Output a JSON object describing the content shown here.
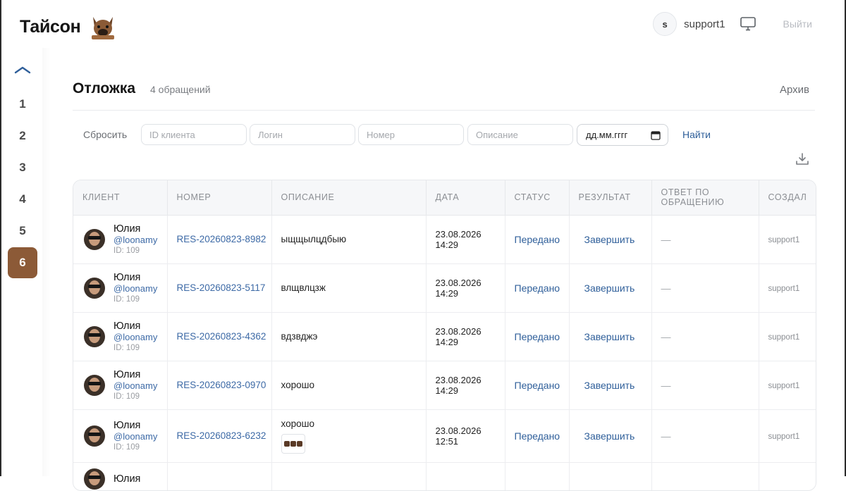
{
  "header": {
    "brand": "Тайсон",
    "user_initial": "s",
    "username": "support1",
    "logout": "Выйти"
  },
  "rail": {
    "items": [
      "1",
      "2",
      "3",
      "4",
      "5",
      "6"
    ],
    "active": "6"
  },
  "page": {
    "title": "Отложка",
    "count": "4 обращений",
    "archive": "Архив"
  },
  "filters": {
    "reset": "Сбросить",
    "client_id_placeholder": "ID клиента",
    "login_placeholder": "Логин",
    "number_placeholder": "Номер",
    "description_placeholder": "Описание",
    "date_placeholder": "дд.мм.гггг",
    "find": "Найти"
  },
  "table": {
    "columns": [
      "КЛИЕНТ",
      "НОМЕР",
      "ОПИСАНИЕ",
      "ДАТА",
      "СТАТУС",
      "РЕЗУЛЬТАТ",
      "ОТВЕТ ПО ОБРАЩЕНИЮ",
      "СОЗДАЛ"
    ],
    "rows": [
      {
        "name": "Юлия",
        "login": "@loonamy",
        "id": "ID: 109",
        "number": "RES-20260823-8982",
        "description": "ыщщылцдбыю",
        "date": "23.08.2026",
        "time": "14:29",
        "status": "Передано",
        "result": "Завершить",
        "answer": "—",
        "creator": "support1"
      },
      {
        "name": "Юлия",
        "login": "@loonamy",
        "id": "ID: 109",
        "number": "RES-20260823-5117",
        "description": "влщвлцзж",
        "date": "23.08.2026",
        "time": "14:29",
        "status": "Передано",
        "result": "Завершить",
        "answer": "—",
        "creator": "support1"
      },
      {
        "name": "Юлия",
        "login": "@loonamy",
        "id": "ID: 109",
        "number": "RES-20260823-4362",
        "description": "вдзвджэ",
        "date": "23.08.2026",
        "time": "14:29",
        "status": "Передано",
        "result": "Завершить",
        "answer": "—",
        "creator": "support1"
      },
      {
        "name": "Юлия",
        "login": "@loonamy",
        "id": "ID: 109",
        "number": "RES-20260823-0970",
        "description": "хорошо",
        "date": "23.08.2026",
        "time": "14:29",
        "status": "Передано",
        "result": "Завершить",
        "answer": "—",
        "creator": "support1"
      },
      {
        "name": "Юлия",
        "login": "@loonamy",
        "id": "ID: 109",
        "number": "RES-20260823-6232",
        "description": "хорошо",
        "date": "23.08.2026",
        "time": "12:51",
        "status": "Передано",
        "result": "Завершить",
        "answer": "—",
        "creator": "support1"
      },
      {
        "name": "Юлия"
      }
    ]
  }
}
